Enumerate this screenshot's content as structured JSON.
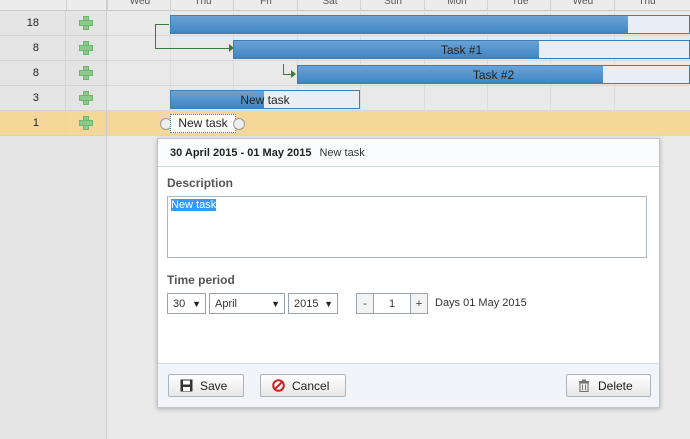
{
  "scale": [
    "Wed",
    "Thu",
    "Fri",
    "Sat",
    "Sun",
    "Mon",
    "Tue",
    "Wed",
    "Thu"
  ],
  "grid_rows": [
    {
      "duration": "18"
    },
    {
      "duration": "8"
    },
    {
      "duration": "8"
    },
    {
      "duration": "3"
    },
    {
      "duration": "1"
    }
  ],
  "tasks": {
    "task1": "Task #1",
    "task2": "Task #2",
    "new_task": "New task",
    "editing": "New task"
  },
  "lightbox": {
    "date_range": "30 April 2015 - 01 May 2015",
    "task_name": "New task",
    "description_label": "Description",
    "description_value": "New task",
    "time_period_label": "Time period",
    "day": "30",
    "month": "April",
    "year": "2015",
    "minus": "-",
    "duration": "1",
    "plus": "+",
    "days_text": "Days 01 May 2015",
    "save_label": "Save",
    "cancel_label": "Cancel",
    "delete_label": "Delete"
  },
  "colors": {
    "bar_fill": "#3f85c2",
    "selected_row": "#f5d79a",
    "link": "#3d7a3d",
    "cancel_icon": "#cc2222"
  }
}
